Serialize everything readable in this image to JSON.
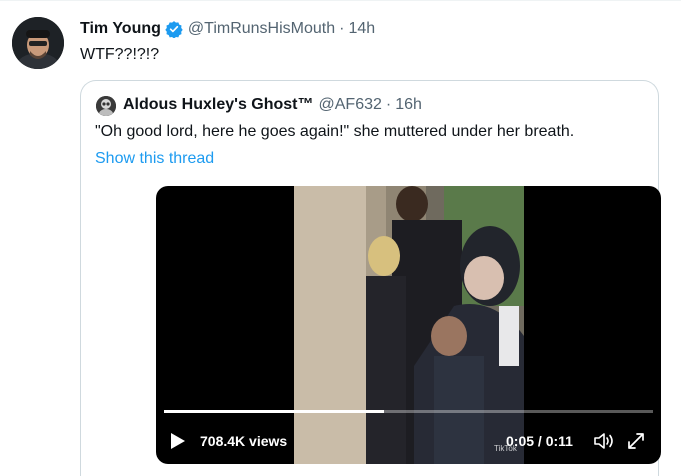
{
  "tweet": {
    "author_name": "Tim Young",
    "author_handle": "@TimRunsHisMouth",
    "separator": "·",
    "time": "14h",
    "text": "WTF??!?!?",
    "avatar_icon": "user-avatar",
    "verified_icon": "verified-badge-icon"
  },
  "quote": {
    "author_name": "Aldous Huxley's Ghost™",
    "author_handle": "@AF632",
    "separator": "·",
    "time": "16h",
    "text": "\"Oh good lord, here he goes again!\" she muttered under her breath.",
    "show_thread": "Show this thread"
  },
  "video": {
    "views": "708.4K views",
    "timecode": "0:05 / 0:11",
    "watermark": "TikTok",
    "progress_fraction": 0.45
  },
  "colors": {
    "link": "#1d9bf0",
    "secondary_text": "#536471",
    "border": "#cfd9de"
  }
}
